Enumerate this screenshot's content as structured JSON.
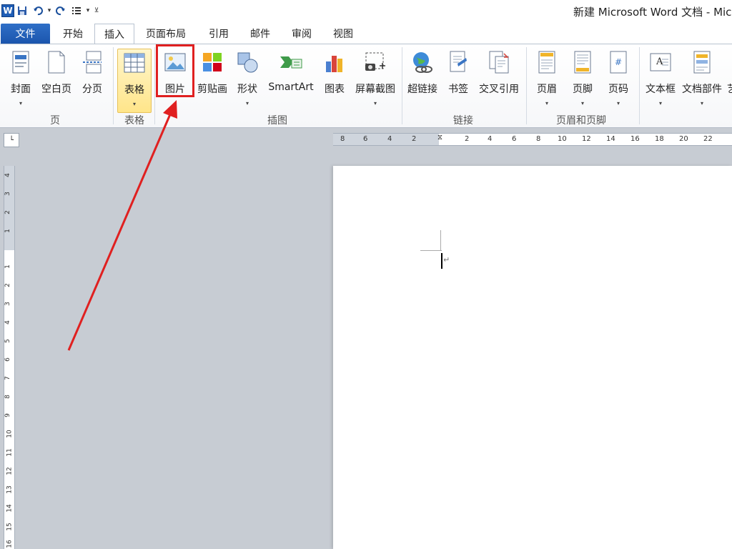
{
  "window": {
    "title": "新建 Microsoft Word 文档 - Mic",
    "app_icon": "W"
  },
  "quick_access": {
    "icons": [
      "save-icon",
      "undo-icon",
      "redo-icon",
      "list-icon",
      "customize-icon"
    ]
  },
  "tabs": [
    {
      "label": "文件"
    },
    {
      "label": "开始"
    },
    {
      "label": "插入"
    },
    {
      "label": "页面布局"
    },
    {
      "label": "引用"
    },
    {
      "label": "邮件"
    },
    {
      "label": "审阅"
    },
    {
      "label": "视图"
    }
  ],
  "active_tab": "插入",
  "ribbon": {
    "groups": {
      "pages": "页",
      "tables": "表格",
      "illustrations": "插图",
      "links": "链接",
      "header_footer": "页眉和页脚"
    },
    "buttons": {
      "cover": "封面",
      "blank": "空白页",
      "pagebreak": "分页",
      "table": "表格",
      "picture": "图片",
      "clipart": "剪贴画",
      "shapes": "形状",
      "smartart": "SmartArt",
      "chart": "图表",
      "screenshot": "屏幕截图",
      "hyperlink": "超链接",
      "bookmark": "书签",
      "crossref": "交叉引用",
      "header": "页眉",
      "footer": "页脚",
      "pagenum": "页码",
      "textbox": "文本框",
      "quickparts": "文档部件",
      "more": "艺"
    }
  },
  "ruler": {
    "h_labels": [
      "8",
      "6",
      "4",
      "2",
      "2",
      "4",
      "6",
      "8",
      "10",
      "12",
      "14",
      "16",
      "18",
      "20",
      "22"
    ],
    "v_labels": [
      "4",
      "3",
      "2",
      "1",
      "1",
      "2",
      "3",
      "4",
      "5",
      "6",
      "7",
      "8",
      "9",
      "10",
      "11",
      "12",
      "13",
      "14",
      "15",
      "16"
    ]
  },
  "annotation": {
    "color": "#e02020",
    "target": "图片"
  }
}
